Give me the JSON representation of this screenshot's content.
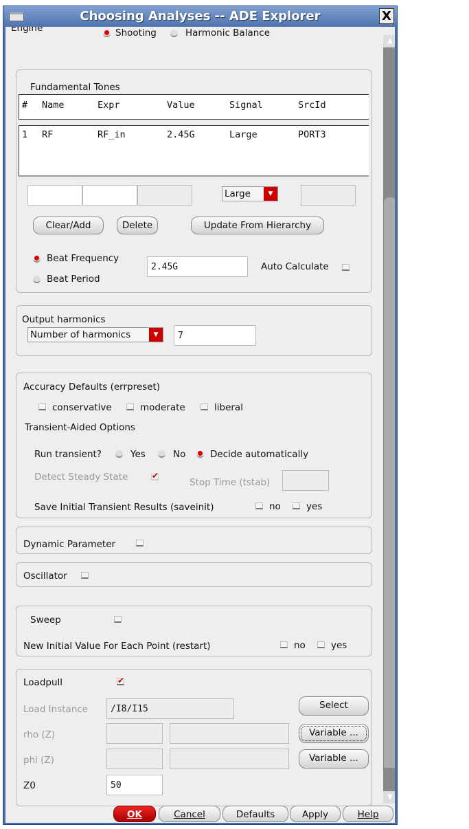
{
  "window": {
    "title": "Choosing Analyses -- ADE Explorer",
    "close": "X"
  },
  "engine": {
    "label": "Engine",
    "options": [
      "Shooting",
      "Harmonic Balance"
    ],
    "selected": "Shooting"
  },
  "tones": {
    "title": "Fundamental Tones",
    "columns": [
      "#",
      "Name",
      "Expr",
      "Value",
      "Signal",
      "SrcId"
    ],
    "rows": [
      [
        "1",
        "RF",
        "RF_in",
        "2.45G",
        "Large",
        "PORT3"
      ]
    ],
    "signal_select": "Large",
    "buttons": [
      "Clear/Add",
      "Delete",
      "Update From Hierarchy"
    ],
    "beat_frequency": "Beat Frequency",
    "beat_period": "Beat Period",
    "beat_value": "2.45G",
    "selected": "Beat Frequency",
    "auto_calculate": "Auto Calculate",
    "auto_calculate_checked": false
  },
  "harmonics": {
    "label": "Output harmonics",
    "select": "Number of harmonics",
    "value": "7"
  },
  "accuracy": {
    "label": "Accuracy Defaults (errpreset)",
    "options": [
      "conservative",
      "moderate",
      "liberal"
    ],
    "transient_title": "Transient-Aided Options",
    "run_transient": "Run transient?",
    "run_options": [
      "Yes",
      "No",
      "Decide automatically"
    ],
    "run_selected": "Decide automatically",
    "detect": "Detect Steady State",
    "detect_checked": true,
    "stop_time": "Stop Time (tstab)",
    "save_init": "Save Initial Transient Results (saveinit)",
    "save_options": [
      "no",
      "yes"
    ]
  },
  "dynamic": {
    "label": "Dynamic Parameter",
    "checked": false
  },
  "oscillator": {
    "label": "Oscillator",
    "checked": false
  },
  "sweep": {
    "label": "Sweep",
    "checked": false,
    "restart": "New Initial Value For Each Point (restart)",
    "restart_options": [
      "no",
      "yes"
    ]
  },
  "loadpull": {
    "label": "Loadpull",
    "checked": true,
    "load_instance": "Load Instance",
    "load_value": "/I8/I15",
    "select": "Select",
    "rho": "rho (Z)",
    "phi": "phi (Z)",
    "variable": "Variable ...",
    "z0": "Z0",
    "z0_value": "50"
  },
  "footer": {
    "ok": "OK",
    "cancel": "Cancel",
    "defaults": "Defaults",
    "apply": "Apply",
    "help": "Help"
  }
}
